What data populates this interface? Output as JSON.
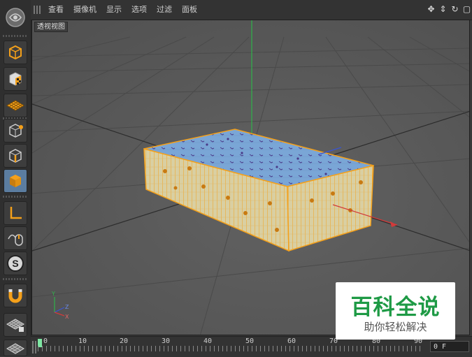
{
  "menu": {
    "items": [
      "查看",
      "摄像机",
      "显示",
      "选项",
      "过滤",
      "面板"
    ]
  },
  "viewport": {
    "label": "透视视图",
    "axis_labels": {
      "y": "Y",
      "z": "Z",
      "x": "X"
    }
  },
  "timeline": {
    "ticks": [
      "0",
      "10",
      "20",
      "30",
      "40",
      "50",
      "60",
      "70",
      "80",
      "90"
    ],
    "current_frame": "0 F"
  },
  "watermark": {
    "title": "百科全说",
    "subtitle": "助你轻松解决"
  },
  "colors": {
    "accent_orange": "#f4a01a",
    "active_tool": "#5b7da0",
    "y_axis": "#2fb34a",
    "x_axis": "#d23a3a",
    "z_axis": "#3a55d2"
  },
  "toolbar_icons": [
    "cinema4d-logo-icon",
    "cube-icon",
    "checker-cube-icon",
    "grid-plane-icon",
    "point-mode-icon",
    "edge-mode-icon",
    "polygon-mode-icon",
    "axis-tool-icon",
    "mouse-tweak-icon",
    "snap-s-icon",
    "magnet-icon",
    "grid-lock-icon",
    "grid-workplane-icon"
  ]
}
